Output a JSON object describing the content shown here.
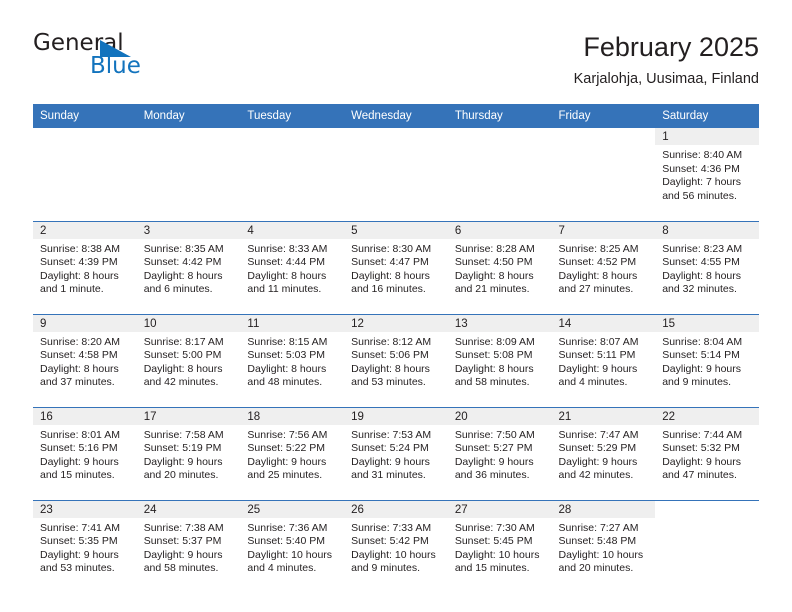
{
  "brand": {
    "name_part1": "General",
    "name_part2": "Blue",
    "flag_icon": "blue-triangle-flag-icon",
    "accent_color": "#1273bd"
  },
  "header": {
    "title": "February 2025",
    "subtitle": "Karjalohja, Uusimaa, Finland"
  },
  "colors": {
    "header_blue": "#3573b9",
    "daynum_band": "#efefef",
    "text": "#231f20"
  },
  "calendar": {
    "weekday_headers": [
      "Sunday",
      "Monday",
      "Tuesday",
      "Wednesday",
      "Thursday",
      "Friday",
      "Saturday"
    ],
    "weeks": [
      [
        {
          "blank": true
        },
        {
          "blank": true
        },
        {
          "blank": true
        },
        {
          "blank": true
        },
        {
          "blank": true
        },
        {
          "blank": true
        },
        {
          "day": "1",
          "sunrise": "Sunrise: 8:40 AM",
          "sunset": "Sunset: 4:36 PM",
          "daylight": "Daylight: 7 hours and 56 minutes."
        }
      ],
      [
        {
          "day": "2",
          "sunrise": "Sunrise: 8:38 AM",
          "sunset": "Sunset: 4:39 PM",
          "daylight": "Daylight: 8 hours and 1 minute."
        },
        {
          "day": "3",
          "sunrise": "Sunrise: 8:35 AM",
          "sunset": "Sunset: 4:42 PM",
          "daylight": "Daylight: 8 hours and 6 minutes."
        },
        {
          "day": "4",
          "sunrise": "Sunrise: 8:33 AM",
          "sunset": "Sunset: 4:44 PM",
          "daylight": "Daylight: 8 hours and 11 minutes."
        },
        {
          "day": "5",
          "sunrise": "Sunrise: 8:30 AM",
          "sunset": "Sunset: 4:47 PM",
          "daylight": "Daylight: 8 hours and 16 minutes."
        },
        {
          "day": "6",
          "sunrise": "Sunrise: 8:28 AM",
          "sunset": "Sunset: 4:50 PM",
          "daylight": "Daylight: 8 hours and 21 minutes."
        },
        {
          "day": "7",
          "sunrise": "Sunrise: 8:25 AM",
          "sunset": "Sunset: 4:52 PM",
          "daylight": "Daylight: 8 hours and 27 minutes."
        },
        {
          "day": "8",
          "sunrise": "Sunrise: 8:23 AM",
          "sunset": "Sunset: 4:55 PM",
          "daylight": "Daylight: 8 hours and 32 minutes."
        }
      ],
      [
        {
          "day": "9",
          "sunrise": "Sunrise: 8:20 AM",
          "sunset": "Sunset: 4:58 PM",
          "daylight": "Daylight: 8 hours and 37 minutes."
        },
        {
          "day": "10",
          "sunrise": "Sunrise: 8:17 AM",
          "sunset": "Sunset: 5:00 PM",
          "daylight": "Daylight: 8 hours and 42 minutes."
        },
        {
          "day": "11",
          "sunrise": "Sunrise: 8:15 AM",
          "sunset": "Sunset: 5:03 PM",
          "daylight": "Daylight: 8 hours and 48 minutes."
        },
        {
          "day": "12",
          "sunrise": "Sunrise: 8:12 AM",
          "sunset": "Sunset: 5:06 PM",
          "daylight": "Daylight: 8 hours and 53 minutes."
        },
        {
          "day": "13",
          "sunrise": "Sunrise: 8:09 AM",
          "sunset": "Sunset: 5:08 PM",
          "daylight": "Daylight: 8 hours and 58 minutes."
        },
        {
          "day": "14",
          "sunrise": "Sunrise: 8:07 AM",
          "sunset": "Sunset: 5:11 PM",
          "daylight": "Daylight: 9 hours and 4 minutes."
        },
        {
          "day": "15",
          "sunrise": "Sunrise: 8:04 AM",
          "sunset": "Sunset: 5:14 PM",
          "daylight": "Daylight: 9 hours and 9 minutes."
        }
      ],
      [
        {
          "day": "16",
          "sunrise": "Sunrise: 8:01 AM",
          "sunset": "Sunset: 5:16 PM",
          "daylight": "Daylight: 9 hours and 15 minutes."
        },
        {
          "day": "17",
          "sunrise": "Sunrise: 7:58 AM",
          "sunset": "Sunset: 5:19 PM",
          "daylight": "Daylight: 9 hours and 20 minutes."
        },
        {
          "day": "18",
          "sunrise": "Sunrise: 7:56 AM",
          "sunset": "Sunset: 5:22 PM",
          "daylight": "Daylight: 9 hours and 25 minutes."
        },
        {
          "day": "19",
          "sunrise": "Sunrise: 7:53 AM",
          "sunset": "Sunset: 5:24 PM",
          "daylight": "Daylight: 9 hours and 31 minutes."
        },
        {
          "day": "20",
          "sunrise": "Sunrise: 7:50 AM",
          "sunset": "Sunset: 5:27 PM",
          "daylight": "Daylight: 9 hours and 36 minutes."
        },
        {
          "day": "21",
          "sunrise": "Sunrise: 7:47 AM",
          "sunset": "Sunset: 5:29 PM",
          "daylight": "Daylight: 9 hours and 42 minutes."
        },
        {
          "day": "22",
          "sunrise": "Sunrise: 7:44 AM",
          "sunset": "Sunset: 5:32 PM",
          "daylight": "Daylight: 9 hours and 47 minutes."
        }
      ],
      [
        {
          "day": "23",
          "sunrise": "Sunrise: 7:41 AM",
          "sunset": "Sunset: 5:35 PM",
          "daylight": "Daylight: 9 hours and 53 minutes."
        },
        {
          "day": "24",
          "sunrise": "Sunrise: 7:38 AM",
          "sunset": "Sunset: 5:37 PM",
          "daylight": "Daylight: 9 hours and 58 minutes."
        },
        {
          "day": "25",
          "sunrise": "Sunrise: 7:36 AM",
          "sunset": "Sunset: 5:40 PM",
          "daylight": "Daylight: 10 hours and 4 minutes."
        },
        {
          "day": "26",
          "sunrise": "Sunrise: 7:33 AM",
          "sunset": "Sunset: 5:42 PM",
          "daylight": "Daylight: 10 hours and 9 minutes."
        },
        {
          "day": "27",
          "sunrise": "Sunrise: 7:30 AM",
          "sunset": "Sunset: 5:45 PM",
          "daylight": "Daylight: 10 hours and 15 minutes."
        },
        {
          "day": "28",
          "sunrise": "Sunrise: 7:27 AM",
          "sunset": "Sunset: 5:48 PM",
          "daylight": "Daylight: 10 hours and 20 minutes."
        },
        {
          "blank": true
        }
      ]
    ]
  }
}
